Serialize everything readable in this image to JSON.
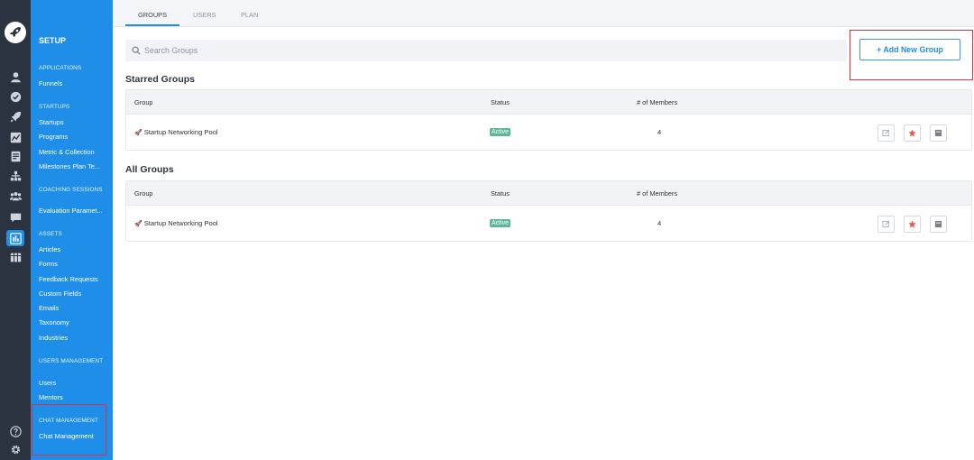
{
  "tabs": [
    "GROUPS",
    "USERS",
    "PLAN"
  ],
  "sidebar": {
    "title": "SETUP",
    "sections": [
      {
        "label": "APPLICATIONS",
        "items": [
          "Funnels"
        ]
      },
      {
        "label": "STARTUPS",
        "items": [
          "Startups",
          "Programs",
          "Metric & Collection",
          "Milestones Plan Te..."
        ]
      },
      {
        "label": "COACHING SESSIONS",
        "items": [
          "Evaluation Paramet..."
        ]
      },
      {
        "label": "ASSETS",
        "items": [
          "Articles",
          "Forms",
          "Feedback Requests",
          "Custom Fields",
          "Emails",
          "Taxonomy",
          "Industries"
        ]
      },
      {
        "label": "USERS MANAGEMENT",
        "items": [
          "Users",
          "Mentors"
        ]
      },
      {
        "label": "CHAT MANAGEMENT",
        "items": [
          "Chat Management"
        ]
      }
    ]
  },
  "search": {
    "placeholder": "Search Groups",
    "value": ""
  },
  "add_button": "+ Add New Group",
  "starred": {
    "heading": "Starred Groups",
    "columns": [
      "Group",
      "Status",
      "# of Members"
    ],
    "rows": [
      {
        "name": "Startup Networking Pool",
        "status": "Active",
        "members": "4"
      }
    ]
  },
  "all": {
    "heading": "All Groups",
    "columns": [
      "Group",
      "Status",
      "# of Members"
    ],
    "rows": [
      {
        "name": "Startup Networking Pool",
        "status": "Active",
        "members": "4"
      }
    ]
  },
  "colors": {
    "accent": "#1e8ee8",
    "rail": "#2b3240",
    "active_badge": "#5bb89a",
    "star": "#e8574a",
    "highlight": "#d9333f"
  },
  "icons": {
    "rail": [
      "rocket-logo-icon",
      "user-icon",
      "check-circle-icon",
      "rocket-icon",
      "chart-icon",
      "document-icon",
      "org-chart-icon",
      "team-icon",
      "chat-icon",
      "dashboard-icon",
      "columns-icon",
      "help-icon",
      "gear-icon"
    ],
    "row_actions": [
      "edit-icon",
      "star-icon",
      "archive-icon"
    ]
  }
}
